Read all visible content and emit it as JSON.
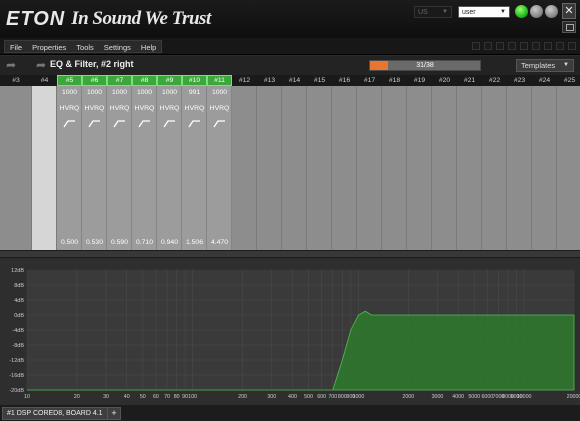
{
  "app": {
    "brand": "ETON",
    "slogan": "In Sound We Trust",
    "language": "US",
    "user": "user"
  },
  "menu": [
    "File",
    "Properties",
    "Tools",
    "Settings",
    "Help"
  ],
  "toolbar": {
    "title": "EQ & Filter, #2 right",
    "progress_text": "31/38",
    "progress_fraction": 0.16,
    "templates_label": "Templates"
  },
  "channels": [
    {
      "label": "#3",
      "active": false
    },
    {
      "label": "#4",
      "active": false
    },
    {
      "label": "#5",
      "active": true
    },
    {
      "label": "#6",
      "active": true
    },
    {
      "label": "#7",
      "active": true
    },
    {
      "label": "#8",
      "active": true
    },
    {
      "label": "#9",
      "active": true
    },
    {
      "label": "#10",
      "active": true
    },
    {
      "label": "#11",
      "active": true
    },
    {
      "label": "#12",
      "active": false
    },
    {
      "label": "#13",
      "active": false
    },
    {
      "label": "#14",
      "active": false
    },
    {
      "label": "#15",
      "active": false
    },
    {
      "label": "#16",
      "active": false
    },
    {
      "label": "#17",
      "active": false
    },
    {
      "label": "#18",
      "active": false
    },
    {
      "label": "#19",
      "active": false
    },
    {
      "label": "#20",
      "active": false
    },
    {
      "label": "#21",
      "active": false
    },
    {
      "label": "#22",
      "active": false
    },
    {
      "label": "#23",
      "active": false
    },
    {
      "label": "#24",
      "active": false
    },
    {
      "label": "#25",
      "active": false
    }
  ],
  "filters": [
    {
      "freq": "1000",
      "type": "HVRQ",
      "q": "0.500"
    },
    {
      "freq": "1000",
      "type": "HVRQ",
      "q": "0.530"
    },
    {
      "freq": "1000",
      "type": "HVRQ",
      "q": "0.590"
    },
    {
      "freq": "1000",
      "type": "HVRQ",
      "q": "0.710"
    },
    {
      "freq": "1000",
      "type": "HVRQ",
      "q": "0.940"
    },
    {
      "freq": "991",
      "type": "HVRQ",
      "q": "1.506"
    },
    {
      "freq": "1000",
      "type": "HVRQ",
      "q": "4.470"
    }
  ],
  "chart_data": {
    "type": "area",
    "title": "",
    "xlabel": "",
    "ylabel": "",
    "x_scale": "log",
    "xlim": [
      10,
      20000
    ],
    "ylim": [
      -20,
      12
    ],
    "y_ticks": [
      "12dB",
      "8dB",
      "4dB",
      "0dB",
      "-4dB",
      "-8dB",
      "-12dB",
      "-16dB",
      "-20dB"
    ],
    "y_tick_values": [
      12,
      8,
      4,
      0,
      -4,
      -8,
      -12,
      -16,
      -20
    ],
    "x_ticks": [
      "10",
      "20",
      "30",
      "40",
      "50",
      "60",
      "70",
      "80",
      "90",
      "100",
      "200",
      "300",
      "400",
      "500",
      "600",
      "700",
      "800",
      "900",
      "1000",
      "2000",
      "3000",
      "4000",
      "5000",
      "6000",
      "7000",
      "8000",
      "9000",
      "10000",
      "20000"
    ],
    "x_tick_values": [
      10,
      20,
      30,
      40,
      50,
      60,
      70,
      80,
      90,
      100,
      200,
      300,
      400,
      500,
      600,
      700,
      800,
      900,
      1000,
      2000,
      3000,
      4000,
      5000,
      6000,
      7000,
      8000,
      9000,
      10000,
      20000
    ],
    "series": [
      {
        "x": [
          10,
          700,
          800,
          900,
          1000,
          1100,
          1200,
          1500,
          2000,
          5000,
          10000,
          20000
        ],
        "y": [
          -20,
          -20,
          -12,
          -4,
          0,
          1,
          0,
          0,
          0,
          0,
          0,
          0
        ]
      }
    ],
    "grid": true,
    "color": "#2e7a2e"
  },
  "bottom": {
    "tab_label": "#1 DSP CORED8, BOARD 4.1",
    "add_label": "+"
  }
}
